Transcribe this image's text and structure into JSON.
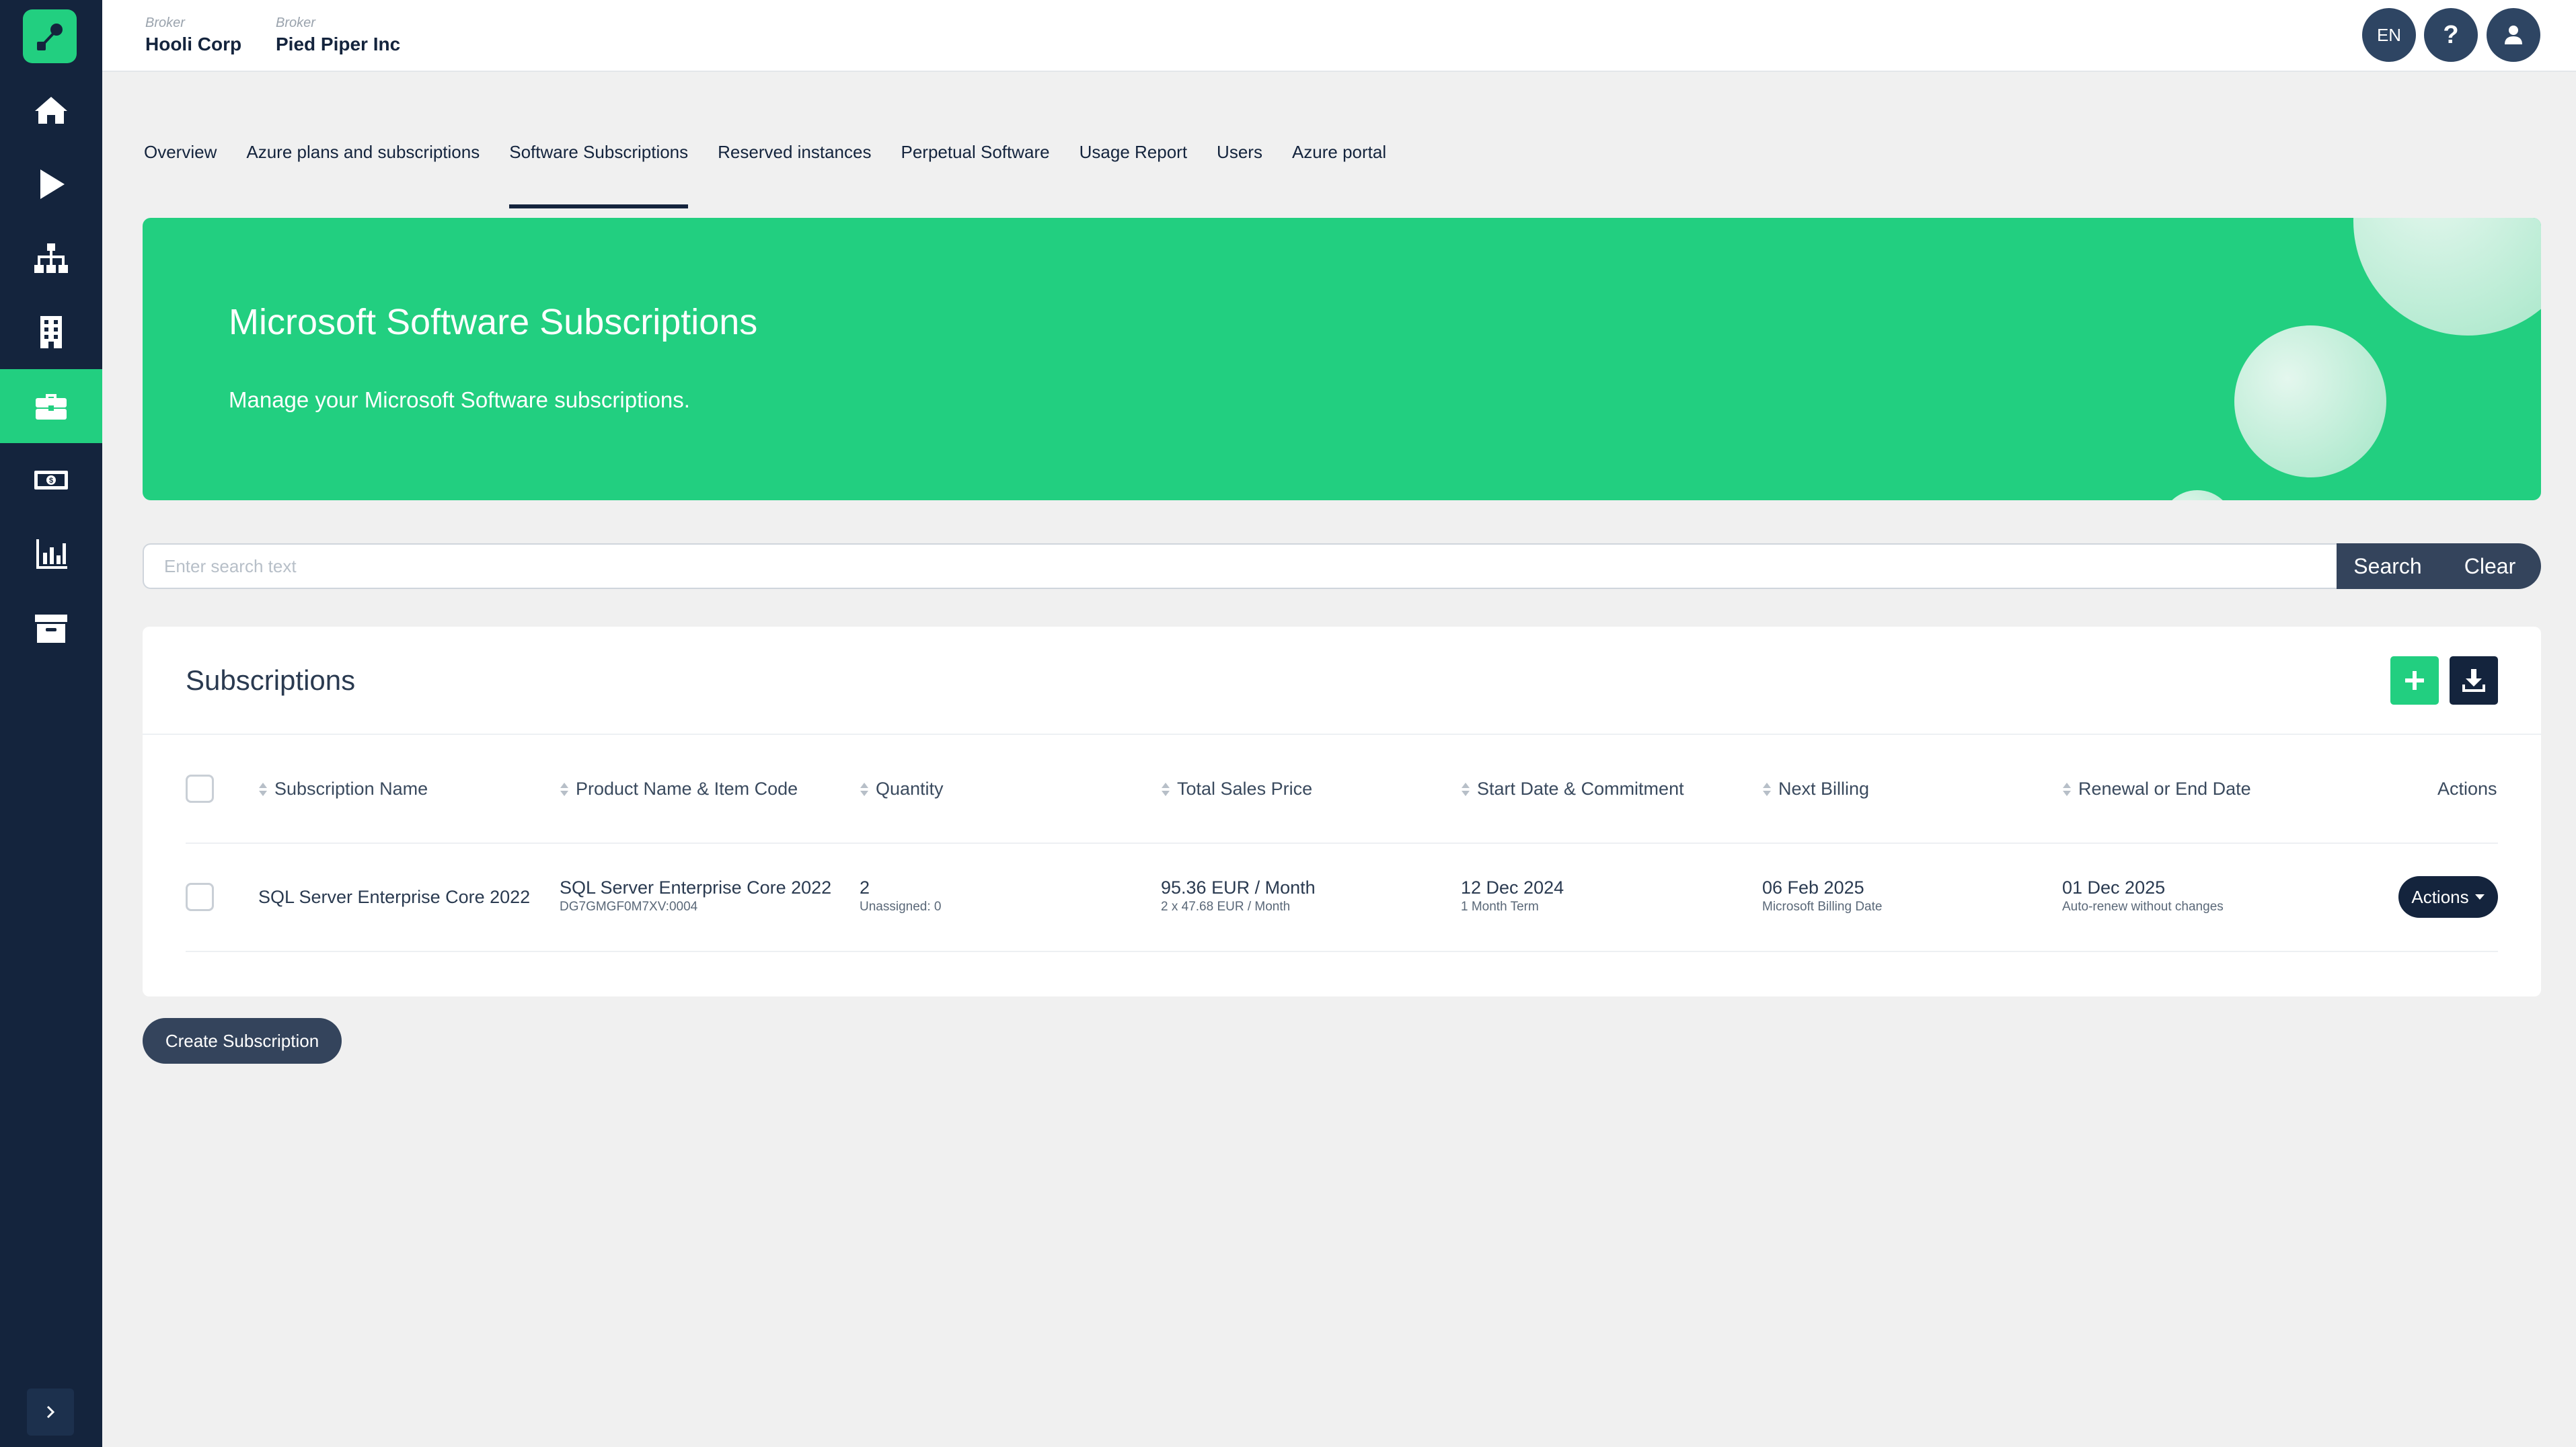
{
  "header": {
    "brokers": [
      {
        "label": "Broker",
        "name": "Hooli Corp"
      },
      {
        "label": "Broker",
        "name": "Pied Piper Inc"
      }
    ],
    "language": "EN",
    "help_label": "?"
  },
  "sidebar": {
    "items": [
      {
        "icon": "home-icon"
      },
      {
        "icon": "play-icon"
      },
      {
        "icon": "hierarchy-icon"
      },
      {
        "icon": "building-icon"
      },
      {
        "icon": "briefcase-icon",
        "active": true
      },
      {
        "icon": "money-icon"
      },
      {
        "icon": "bar-chart-icon"
      },
      {
        "icon": "archive-icon"
      }
    ],
    "accent_color": "#22cf80",
    "background_color": "#14243d"
  },
  "tabs": [
    {
      "label": "Overview"
    },
    {
      "label": "Azure plans and subscriptions"
    },
    {
      "label": "Software Subscriptions",
      "active": true
    },
    {
      "label": "Reserved instances"
    },
    {
      "label": "Perpetual Software"
    },
    {
      "label": "Usage Report"
    },
    {
      "label": "Users"
    },
    {
      "label": "Azure portal"
    }
  ],
  "hero": {
    "title": "Microsoft Software Subscriptions",
    "subtitle": "Manage your Microsoft Software subscriptions."
  },
  "search": {
    "placeholder": "Enter search text",
    "value": "",
    "search_label": "Search",
    "clear_label": "Clear"
  },
  "subscriptions": {
    "title": "Subscriptions",
    "columns": [
      "Subscription Name",
      "Product Name & Item Code",
      "Quantity",
      "Total Sales Price",
      "Start Date & Commitment",
      "Next Billing",
      "Renewal or End Date",
      "Actions"
    ],
    "rows": [
      {
        "subscription_name": "SQL Server Enterprise Core 2022",
        "product_name": "SQL Server Enterprise Core 2022",
        "item_code": "DG7GMGF0M7XV:0004",
        "quantity": "2",
        "unassigned": "Unassigned: 0",
        "total_price": "95.36 EUR / Month",
        "unit_price": "2 x 47.68 EUR / Month",
        "start_date": "12 Dec 2024",
        "commitment": "1 Month Term",
        "next_billing": "06 Feb 2025",
        "billing_note": "Microsoft Billing Date",
        "renewal_date": "01 Dec 2025",
        "renewal_note": "Auto-renew without changes",
        "actions_label": "Actions"
      }
    ]
  },
  "create_button_label": "Create Subscription"
}
